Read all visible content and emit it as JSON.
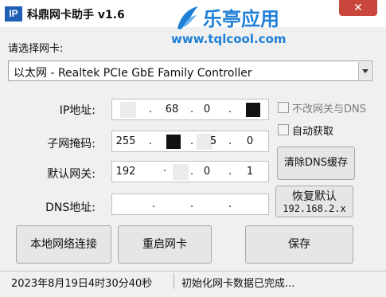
{
  "window": {
    "icon_text": "IP",
    "title": "科鼎网卡助手 v1.6",
    "close_label": "✕"
  },
  "brand": {
    "name": "乐亭应用",
    "url": "www.tqlcool.com"
  },
  "adapter": {
    "label": "请选择网卡:",
    "selected": "以太网 - Realtek PCIe GbE Family Controller"
  },
  "fields": {
    "ip": {
      "label": "IP地址:",
      "octets": [
        "",
        "68",
        "0",
        ""
      ]
    },
    "mask": {
      "label": "子网掩码:",
      "octets": [
        "255",
        "",
        "5",
        "0"
      ]
    },
    "gateway": {
      "label": "默认网关:",
      "octets": [
        "192",
        "",
        "0",
        "1"
      ]
    },
    "dns": {
      "label": "DNS地址:",
      "octets": [
        "",
        "",
        "",
        ""
      ]
    }
  },
  "options": {
    "keep_dns": {
      "label": "不改网关与DNS",
      "checked": false
    },
    "auto_get": {
      "label": "自动获取",
      "checked": false
    }
  },
  "buttons": {
    "clear_dns": "清除DNS缓存",
    "restore_default_line1": "恢复默认",
    "restore_default_line2": "192.168.2.x",
    "local_connection": "本地网络连接",
    "restart_nic": "重启网卡",
    "save": "保存"
  },
  "status": {
    "time": "2023年8月19日4时30分40秒",
    "message": "初始化网卡数据已完成..."
  },
  "colors": {
    "accent": "#1f7fd6",
    "close": "#c9463d"
  }
}
